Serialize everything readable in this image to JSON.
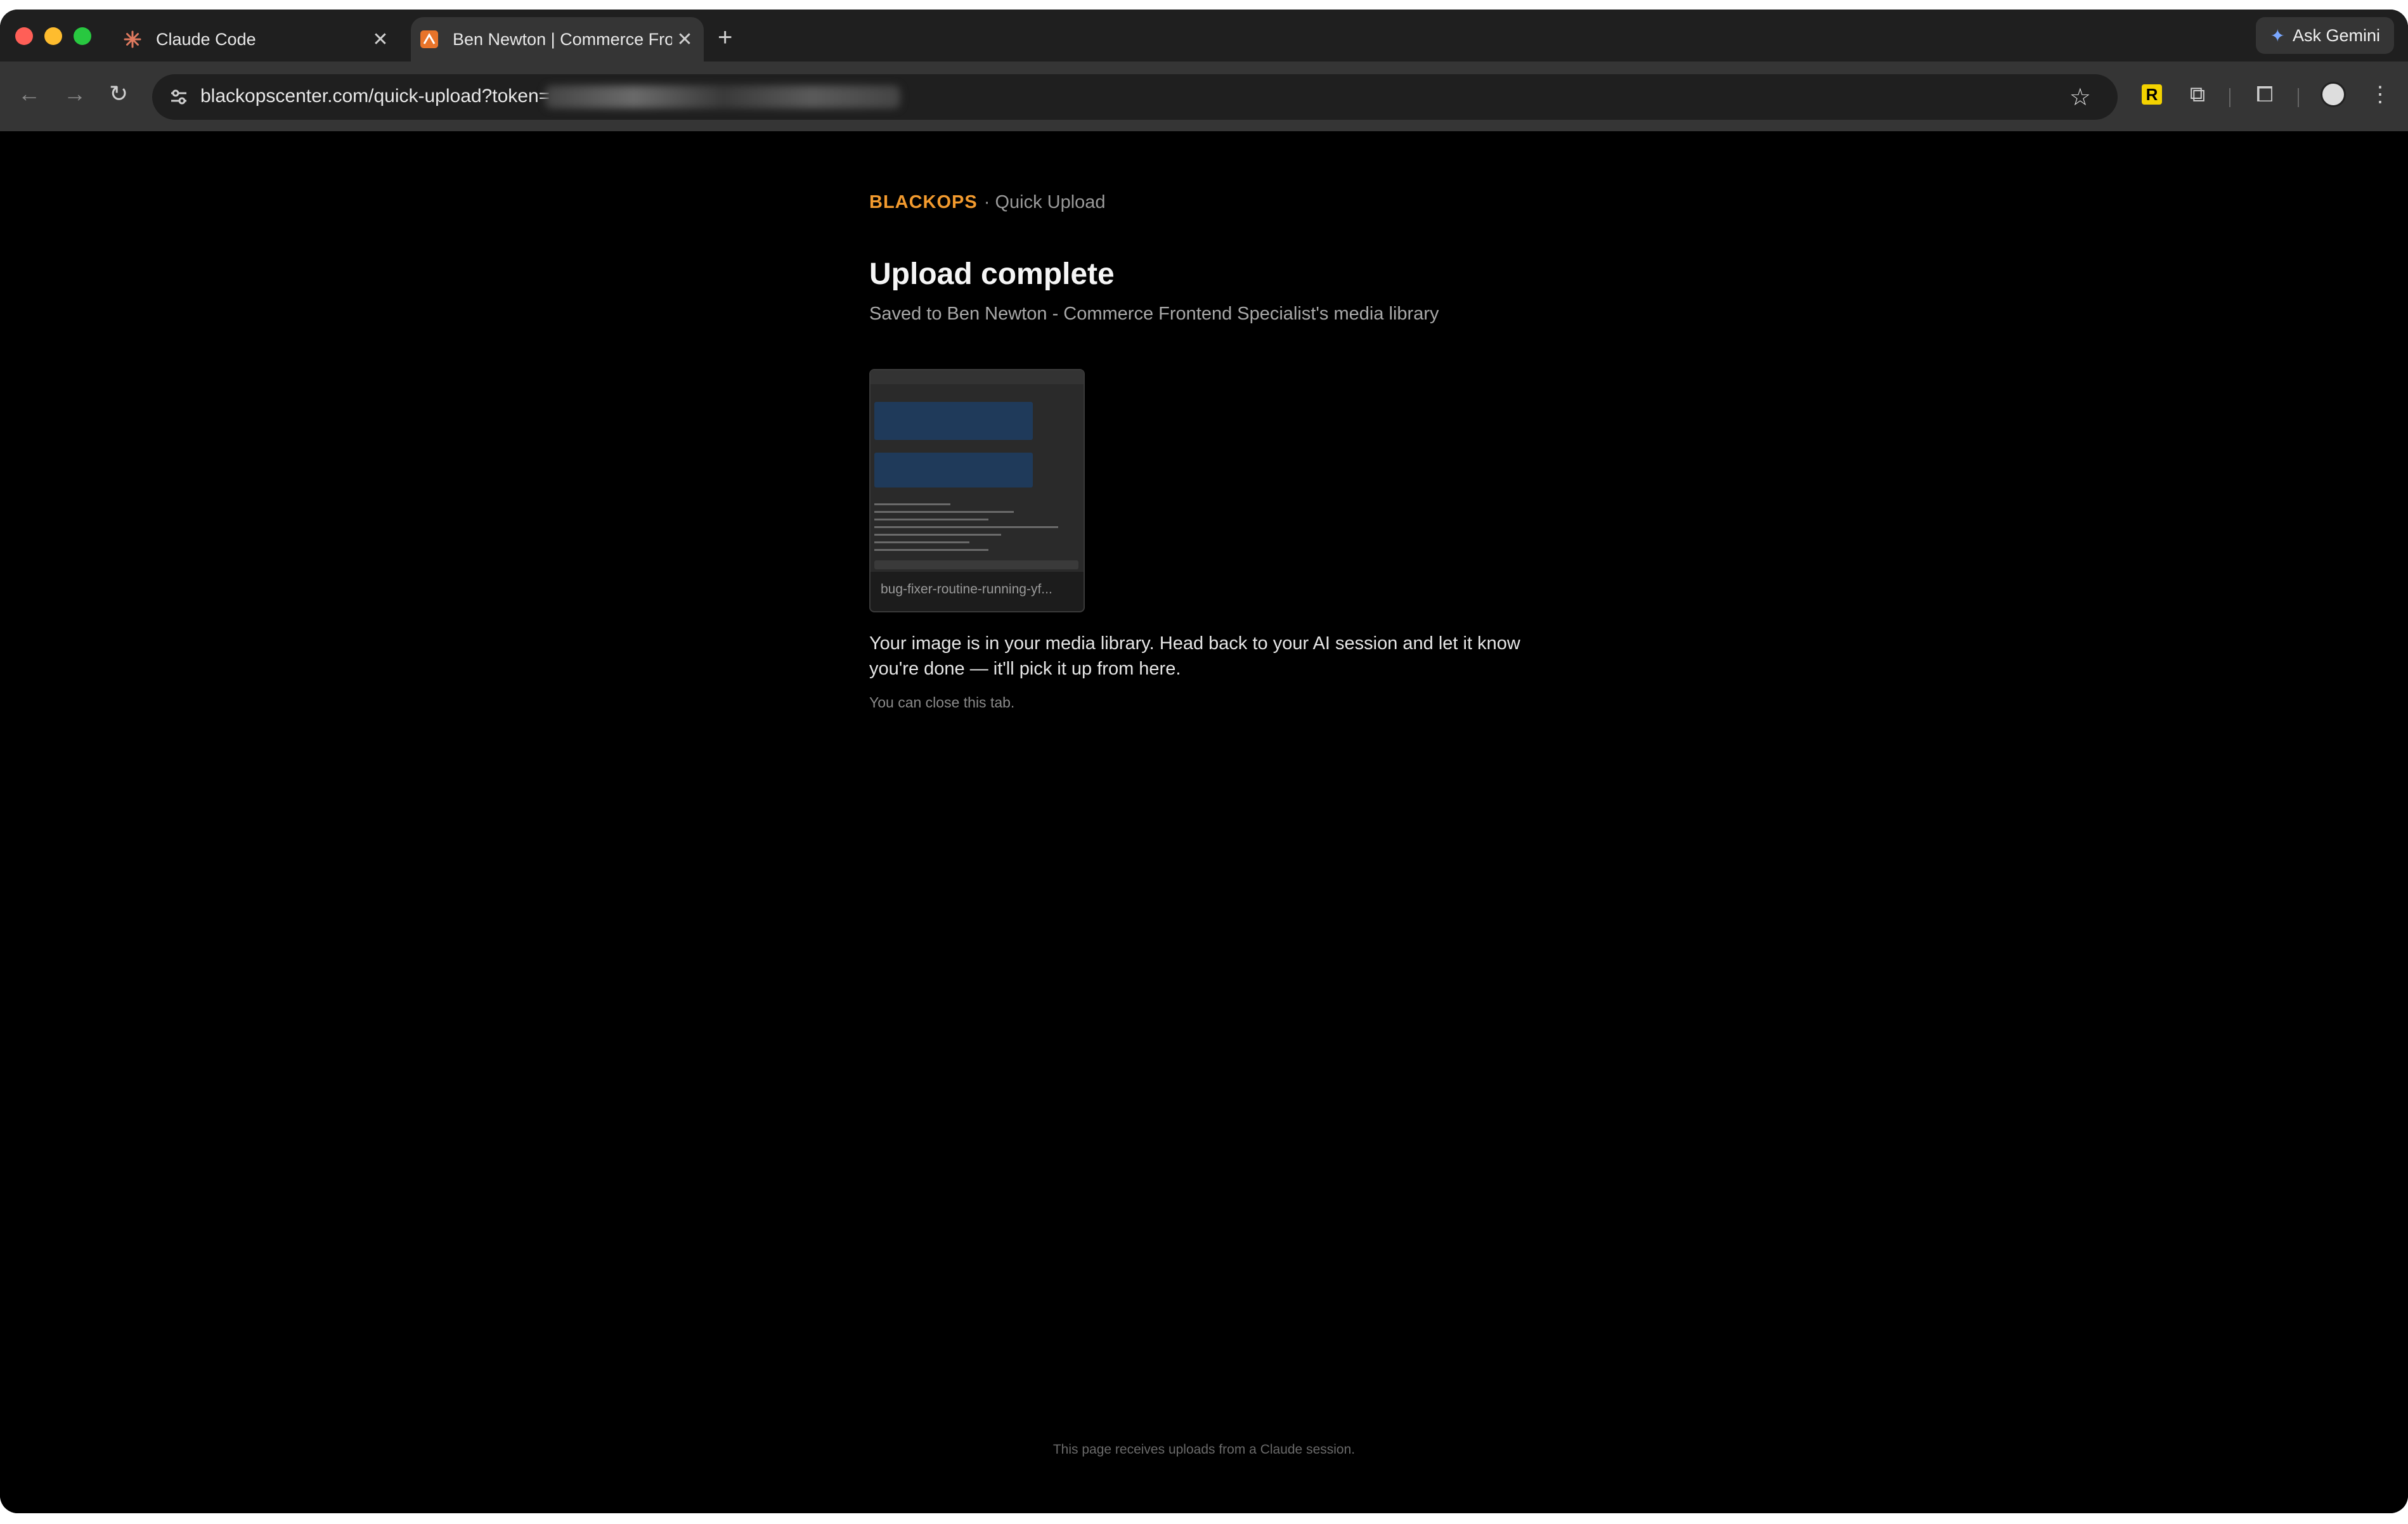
{
  "browser": {
    "tabs": [
      {
        "title": "Claude Code",
        "favicon": "claude-asterisk-icon",
        "active": false
      },
      {
        "title": "Ben Newton | Commerce Fron",
        "favicon": "blackops-logo-icon",
        "active": true
      }
    ],
    "new_tab_label": "+",
    "gemini_label": "Ask Gemini",
    "url": "blackopscenter.com/quick-upload?token="
  },
  "page": {
    "brand_name": "BLACKOPS",
    "brand_section": "· Quick Upload",
    "heading": "Upload complete",
    "subtitle": "Saved to Ben Newton - Commerce Frontend Specialist's media library",
    "thumbnail_caption": "bug-fixer-routine-running-yf...",
    "message": "Your image is in your media library. Head back to your AI session and let it know you're done — it'll pick it up from here.",
    "close_hint": "You can close this tab.",
    "footer": "This page receives uploads from a Claude session."
  },
  "colors": {
    "brand_accent": "#f29a2e",
    "background": "#000000"
  }
}
